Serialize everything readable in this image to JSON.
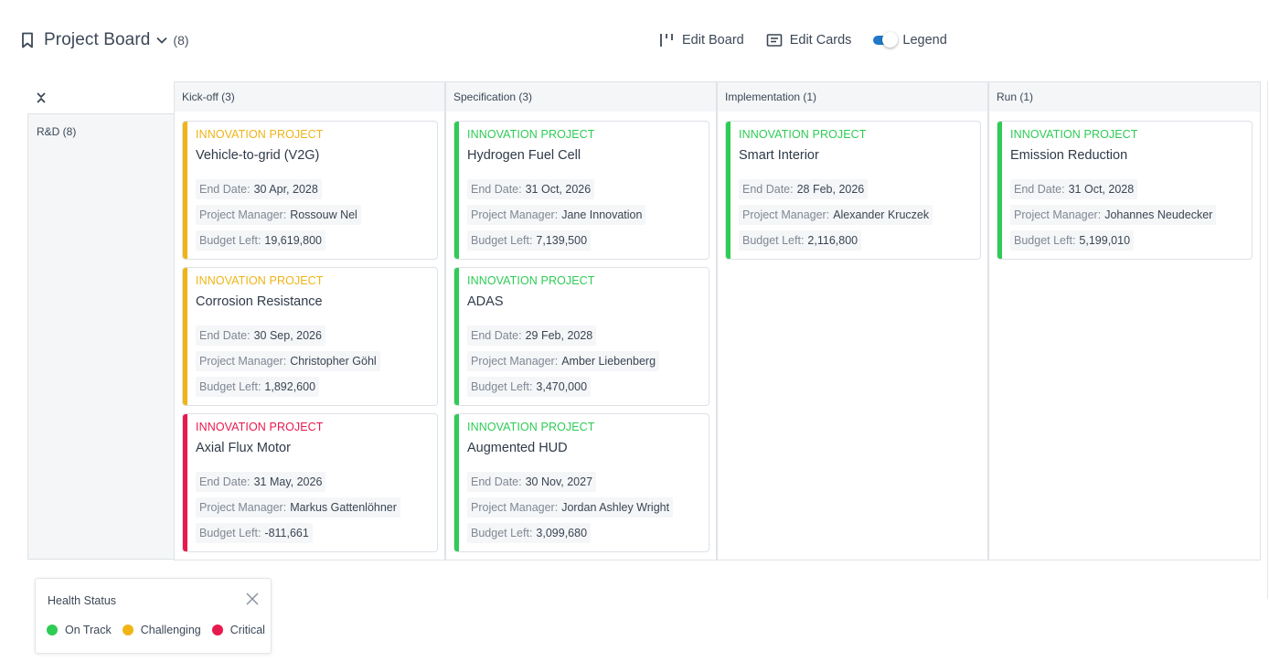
{
  "header": {
    "title": "Project Board",
    "count": "(8)",
    "edit_board": "Edit Board",
    "edit_cards": "Edit Cards",
    "legend_label": "Legend",
    "legend_toggle_on": true
  },
  "board": {
    "lane": {
      "label": "R&D (8)"
    },
    "columns": [
      {
        "label": "Kick-off (3)",
        "cards": [
          {
            "type": "INNOVATION PROJECT",
            "name": "Vehicle-to-grid (V2G)",
            "status": "challenging",
            "end_date": "30 Apr, 2028",
            "manager": "Rossouw Nel",
            "budget": "19,619,800"
          },
          {
            "type": "INNOVATION PROJECT",
            "name": "Corrosion Resistance",
            "status": "challenging",
            "end_date": "30 Sep, 2026",
            "manager": "Christopher Göhl",
            "budget": "1,892,600"
          },
          {
            "type": "INNOVATION PROJECT",
            "name": "Axial Flux Motor",
            "status": "critical",
            "end_date": "31 May, 2026",
            "manager": "Markus Gattenlöhner",
            "budget": "-811,661"
          }
        ]
      },
      {
        "label": "Specification (3)",
        "cards": [
          {
            "type": "INNOVATION PROJECT",
            "name": "Hydrogen Fuel Cell",
            "status": "on_track",
            "end_date": "31 Oct, 2026",
            "manager": "Jane Innovation",
            "budget": "7,139,500"
          },
          {
            "type": "INNOVATION PROJECT",
            "name": "ADAS",
            "status": "on_track",
            "end_date": "29 Feb, 2028",
            "manager": "Amber Liebenberg",
            "budget": "3,470,000"
          },
          {
            "type": "INNOVATION PROJECT",
            "name": "Augmented HUD",
            "status": "on_track",
            "end_date": "30 Nov, 2027",
            "manager": "Jordan Ashley Wright",
            "budget": "3,099,680"
          }
        ]
      },
      {
        "label": "Implementation (1)",
        "cards": [
          {
            "type": "INNOVATION PROJECT",
            "name": "Smart Interior",
            "status": "on_track",
            "end_date": "28 Feb, 2026",
            "manager": "Alexander Kruczek",
            "budget": "2,116,800"
          }
        ]
      },
      {
        "label": "Run (1)",
        "cards": [
          {
            "type": "INNOVATION PROJECT",
            "name": "Emission Reduction",
            "status": "on_track",
            "end_date": "31 Oct, 2028",
            "manager": "Johannes Neudecker",
            "budget": "5,199,010"
          }
        ]
      }
    ],
    "field_labels": {
      "end_date": "End Date:",
      "manager": "Project Manager:",
      "budget": "Budget Left:"
    }
  },
  "legend": {
    "title": "Health Status",
    "items": [
      {
        "label": "On Track",
        "color": "#2ecc55"
      },
      {
        "label": "Challenging",
        "color": "#f0b416"
      },
      {
        "label": "Critical",
        "color": "#e8194f"
      }
    ]
  },
  "status_colors": {
    "on_track": "#2ecc55",
    "challenging": "#f0b416",
    "critical": "#e8194f"
  },
  "accent_color": "#1f78c9",
  "icons": [
    "bookmark-icon",
    "chevron-down-icon",
    "edit-board-icon",
    "edit-cards-icon",
    "collapse-icon",
    "close-icon"
  ]
}
